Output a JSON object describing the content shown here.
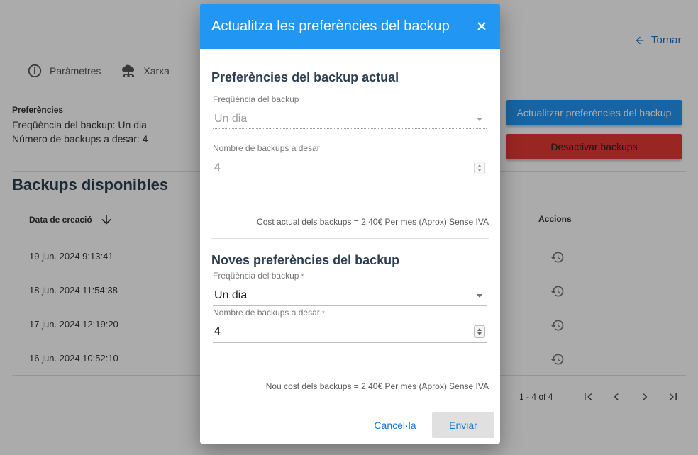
{
  "background": {
    "back_link": "Tornar",
    "tabs": [
      {
        "label": "Paràmetres",
        "icon": "info-icon"
      },
      {
        "label": "Xarxa",
        "icon": "network-cloud-icon"
      }
    ],
    "preferences": {
      "title": "Preferències",
      "frequency_line": "Freqüència del backup: Un dia",
      "count_line": "Número de backups a desar: 4"
    },
    "update_button": "Actualitzar preferències del backup",
    "disable_button": "Desactivar backups",
    "section_title": "Backups disponibles",
    "table": {
      "col_date": "Data de creació",
      "col_actions": "Accions",
      "rows": [
        {
          "date": "19 jun. 2024 9:13:41"
        },
        {
          "date": "18 jun. 2024 11:54:38"
        },
        {
          "date": "17 jun. 2024 12:19:20"
        },
        {
          "date": "16 jun. 2024 10:52:10"
        }
      ]
    },
    "pagination": {
      "range": "1 - 4 of 4"
    }
  },
  "dialog": {
    "title": "Actualitza les preferències del backup",
    "current": {
      "heading": "Preferències del backup actual",
      "frequency_label": "Freqüència del backup",
      "frequency_value": "Un dia",
      "count_label": "Nombre de backups a desar",
      "count_value": "4",
      "cost": "Cost actual dels backups = 2,40€ Per mes (Aprox) Sense IVA"
    },
    "new": {
      "heading": "Noves preferències del backup",
      "frequency_label": "Freqüència del backup",
      "frequency_value": "Un dia",
      "count_label": "Nombre de backups a desar",
      "count_value": "4",
      "required_mark": "*",
      "cost": "Nou cost dels backups = 2,40€ Per mes (Aprox) Sense IVA"
    },
    "cancel_button": "Cancel·la",
    "submit_button": "Enviar"
  },
  "colors": {
    "primary": "#2196f3",
    "danger": "#e53935",
    "heading": "#2c3e50"
  }
}
